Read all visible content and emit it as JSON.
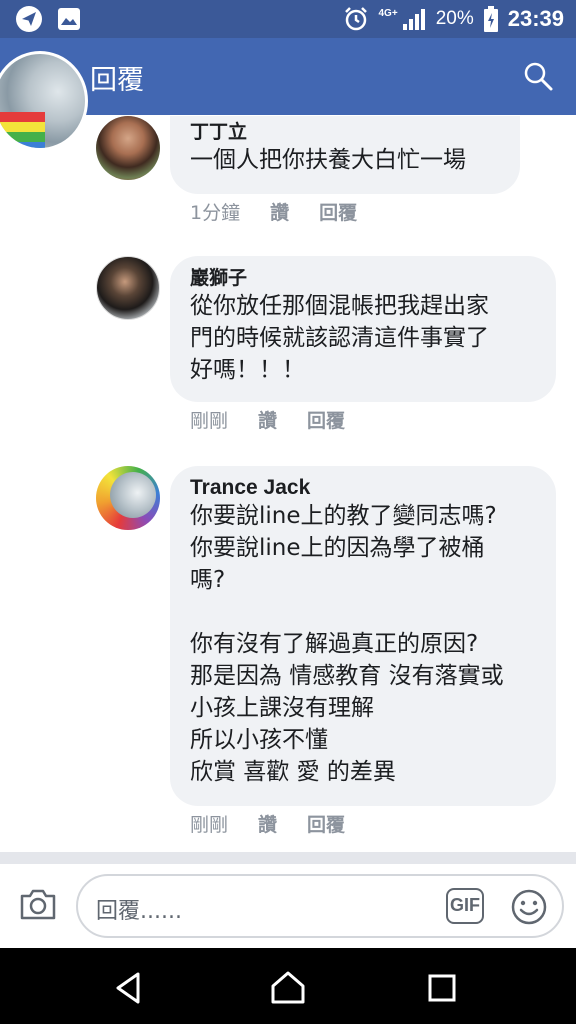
{
  "status_bar": {
    "network": "4G+",
    "battery": "20%",
    "clock": "23:39"
  },
  "app_bar": {
    "title": "回覆"
  },
  "comments": [
    {
      "author": "丁丁立",
      "text": "一個人把你扶養大白忙一場",
      "time": "1分鐘",
      "like": "讚",
      "reply": "回覆"
    },
    {
      "author": "巖獅子",
      "text": "從你放任那個混帳把我趕出家\n門的時候就該認清這件事實了\n好嗎！！！",
      "time": "剛剛",
      "like": "讚",
      "reply": "回覆"
    },
    {
      "author": "Trance Jack",
      "text": "你要說line上的教了變同志嗎?\n你要說line上的因為學了被桶\n嗎?\n\n你有沒有了解過真正的原因?\n那是因為 情感教育 沒有落實或\n小孩上課沒有理解\n所以小孩不懂\n欣賞 喜歡 愛 的差異",
      "time": "剛剛",
      "like": "讚",
      "reply": "回覆"
    }
  ],
  "composer": {
    "placeholder": "回覆......",
    "gif_label": "GIF"
  },
  "colors": {
    "status_bar": "#3b5998",
    "app_bar": "#4267b2",
    "bubble": "#f0f2f5",
    "meta": "#8d949e"
  },
  "icons": {
    "status_left": [
      "telegram-icon",
      "gallery-icon"
    ],
    "status_right": [
      "alarm-icon",
      "signal-icon",
      "battery-icon"
    ],
    "app_bar": [
      "search-icon"
    ],
    "composer": [
      "camera-icon",
      "gif-icon",
      "emoji-icon"
    ],
    "nav": [
      "back-icon",
      "home-icon",
      "recents-icon"
    ]
  }
}
